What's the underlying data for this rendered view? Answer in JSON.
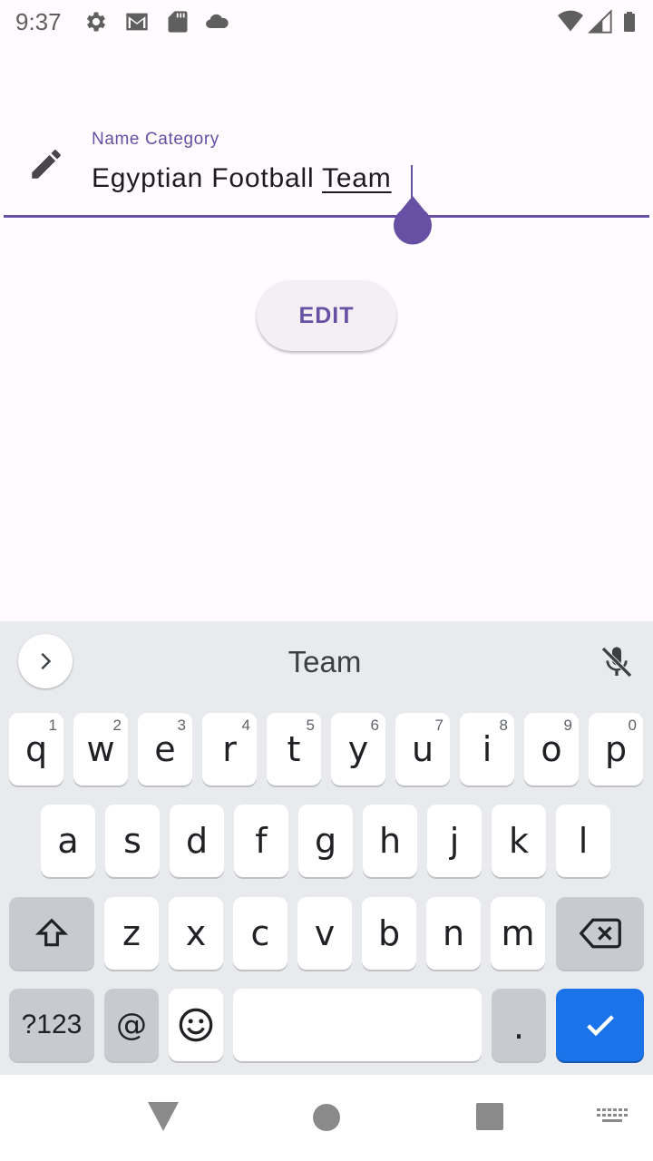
{
  "status_bar": {
    "time": "9:37",
    "left_icons": [
      "gear-icon",
      "gmail-icon",
      "sd-card-icon",
      "cloud-icon"
    ],
    "right_icons": [
      "wifi-icon",
      "signal-icon",
      "battery-icon"
    ]
  },
  "form": {
    "field_label": "Name Category",
    "value_prefix": "Egyptian Football ",
    "value_composing": "Team",
    "edit_button_label": "EDIT",
    "accent_color": "#6750a4"
  },
  "keyboard": {
    "suggestion": "Team",
    "row1": [
      {
        "key": "q",
        "hint": "1"
      },
      {
        "key": "w",
        "hint": "2"
      },
      {
        "key": "e",
        "hint": "3"
      },
      {
        "key": "r",
        "hint": "4"
      },
      {
        "key": "t",
        "hint": "5"
      },
      {
        "key": "y",
        "hint": "6"
      },
      {
        "key": "u",
        "hint": "7"
      },
      {
        "key": "i",
        "hint": "8"
      },
      {
        "key": "o",
        "hint": "9"
      },
      {
        "key": "p",
        "hint": "0"
      }
    ],
    "row2": [
      "a",
      "s",
      "d",
      "f",
      "g",
      "h",
      "j",
      "k",
      "l"
    ],
    "row3": [
      "z",
      "x",
      "c",
      "v",
      "b",
      "n",
      "m"
    ],
    "symbols_key": "?123",
    "at_key": "@",
    "period_key": ".",
    "enter_color": "#1a73e8"
  },
  "nav_bar": {
    "buttons": [
      "back-icon",
      "home-icon",
      "recents-icon",
      "keyboard-switch-icon"
    ]
  }
}
